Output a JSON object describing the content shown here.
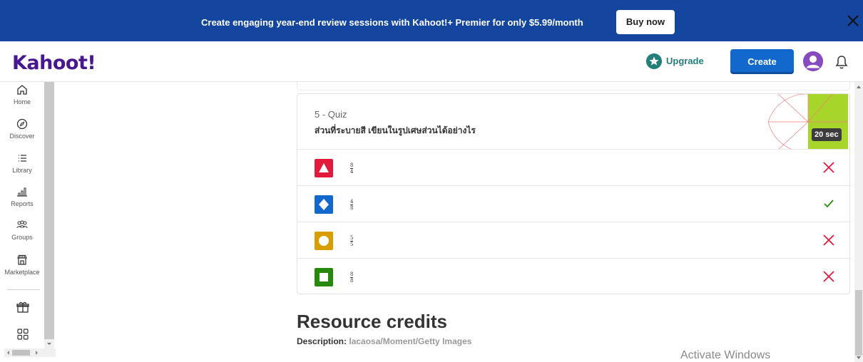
{
  "banner": {
    "text": "Create engaging year-end review sessions with Kahoot!+ Premier for only $5.99/month",
    "buy_label": "Buy now"
  },
  "header": {
    "logo": "Kahoot!",
    "upgrade_label": "Upgrade",
    "create_label": "Create"
  },
  "sidebar": {
    "items": [
      {
        "label": "Home",
        "icon": "home-icon"
      },
      {
        "label": "Discover",
        "icon": "compass-icon"
      },
      {
        "label": "Library",
        "icon": "list-icon"
      },
      {
        "label": "Reports",
        "icon": "bar-chart-icon"
      },
      {
        "label": "Groups",
        "icon": "group-icon"
      },
      {
        "label": "Marketplace",
        "icon": "store-icon"
      }
    ]
  },
  "question": {
    "type": "5 - Quiz",
    "text": "ส่วนที่ระบายสี เขียนในรูปเศษส่วนได้อย่างไร",
    "timer": "20 sec",
    "answers": [
      {
        "numerator": "8",
        "denominator": "4",
        "shape": "triangle",
        "color": "#e21b3c",
        "correct": false
      },
      {
        "numerator": "4",
        "denominator": "8",
        "shape": "diamond",
        "color": "#1368ce",
        "correct": true
      },
      {
        "numerator": "5",
        "denominator": "5",
        "shape": "circle",
        "color": "#d89e00",
        "correct": false
      },
      {
        "numerator": "8",
        "denominator": "8",
        "shape": "square",
        "color": "#26890c",
        "correct": false
      }
    ]
  },
  "resources": {
    "title": "Resource credits",
    "desc_key": "Description:",
    "desc_value": "lacaosa/Moment/Getty Images"
  },
  "watermark": "Activate Windows",
  "colors": {
    "banner": "#1446a0",
    "logo": "#46178f",
    "upgrade": "#237f7a",
    "create": "#1368ce",
    "wrong": "#e21b3c",
    "right": "#26890c",
    "image_green": "#a8d52a"
  }
}
